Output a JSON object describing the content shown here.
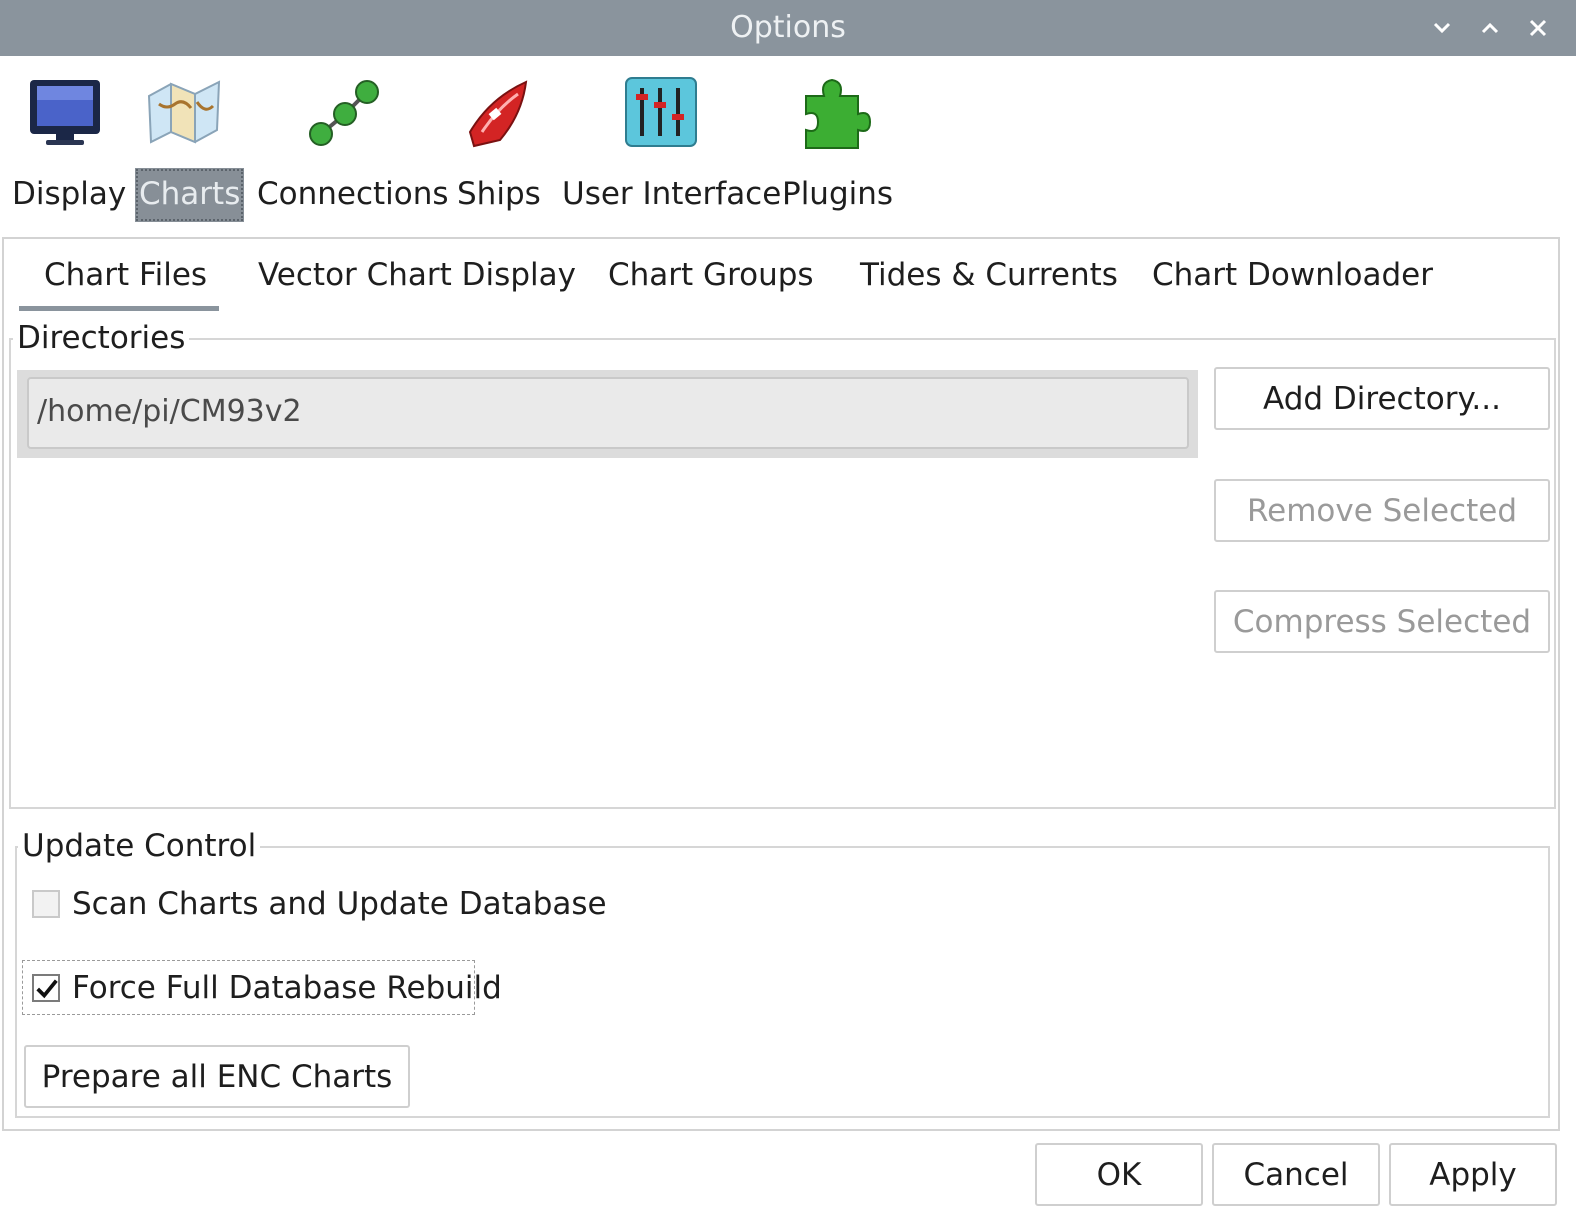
{
  "window": {
    "title": "Options"
  },
  "categories": [
    {
      "label": "Display",
      "icon": "monitor-icon"
    },
    {
      "label": "Charts",
      "icon": "folded-map-icon",
      "active": true
    },
    {
      "label": "Connections",
      "icon": "network-nodes-icon"
    },
    {
      "label": "Ships",
      "icon": "red-boat-icon"
    },
    {
      "label": "User Interface",
      "icon": "sliders-icon"
    },
    {
      "label": "Plugins",
      "icon": "puzzle-piece-icon"
    }
  ],
  "tabs": [
    {
      "label": "Chart Files",
      "active": true
    },
    {
      "label": "Vector Chart Display"
    },
    {
      "label": "Chart Groups"
    },
    {
      "label": "Tides & Currents"
    },
    {
      "label": "Chart Downloader"
    }
  ],
  "directories": {
    "legend": "Directories",
    "items": [
      "/home/pi/CM93v2"
    ],
    "add_label": "Add Directory...",
    "remove_label": "Remove Selected",
    "compress_label": "Compress Selected"
  },
  "update_control": {
    "legend": "Update Control",
    "scan_label": "Scan Charts and Update Database",
    "scan_checked": false,
    "rebuild_label": "Force Full Database Rebuild",
    "rebuild_checked": true,
    "prepare_label": "Prepare all ENC Charts"
  },
  "footer": {
    "ok_label": "OK",
    "cancel_label": "Cancel",
    "apply_label": "Apply"
  },
  "colors": {
    "titlebar": "#8a949d",
    "active_category": "#878f97"
  }
}
